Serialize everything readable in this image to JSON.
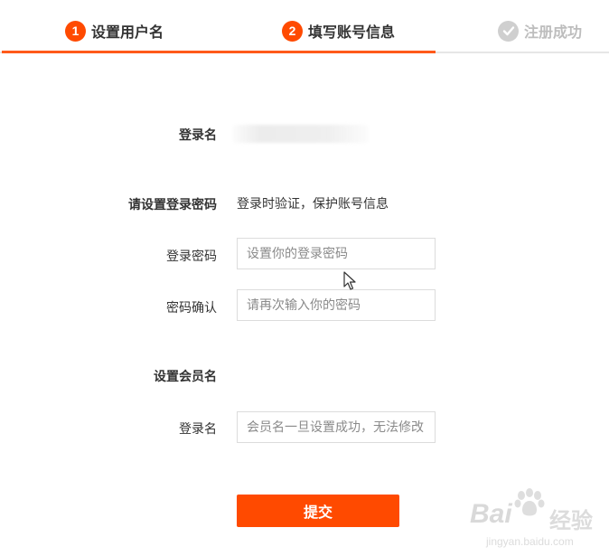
{
  "steps": [
    {
      "number": "1",
      "label": "设置用户名",
      "state": "done"
    },
    {
      "number": "2",
      "label": "填写账号信息",
      "state": "current"
    },
    {
      "label": "注册成功",
      "state": "pending",
      "icon": "check-circle-icon"
    }
  ],
  "colors": {
    "accent": "#ff4a00",
    "inactive": "#bdbdbd"
  },
  "form": {
    "login_name_label": "登录名",
    "password_section_label": "请设置登录密码",
    "password_hint": "登录时验证，保护账号信息",
    "password_label": "登录密码",
    "password_placeholder": "设置你的登录密码",
    "confirm_label": "密码确认",
    "confirm_placeholder": "请再次输入你的密码",
    "member_section_label": "设置会员名",
    "member_name_label": "登录名",
    "member_name_placeholder": "会员名一旦设置成功，无法修改",
    "submit_label": "提交"
  },
  "watermark": {
    "brand": "Bai",
    "cn": "经验",
    "url": "jingyan.baidu.com"
  }
}
